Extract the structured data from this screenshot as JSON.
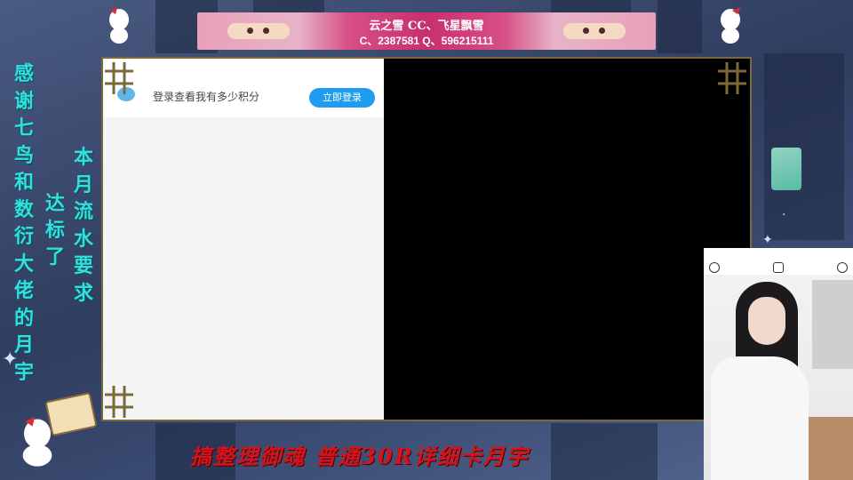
{
  "banner": {
    "line1": "云之雪 CC、飞星飘雪",
    "line2": "C、2387581 Q、596215111"
  },
  "left_column": {
    "text": "感谢七鸟和数衍大佬的月宇"
  },
  "middle_column": {
    "text": "达标了"
  },
  "right_column": {
    "text": "本月流水要求"
  },
  "panel": {
    "login_prompt": "登录查看我有多少积分",
    "login_button": "立即登录"
  },
  "bottom_caption": "搞整理御魂 普通30R详细卡月宇",
  "colors": {
    "frame_border": "#7a6a3a",
    "banner_accent": "#c82f6e",
    "side_text": "#2fe0dd",
    "caption": "#d4141c",
    "login_button": "#1f9cf0"
  },
  "icons": {
    "webcam_toolbar": [
      "minus-circle-icon",
      "fullscreen-icon",
      "refresh-icon"
    ]
  }
}
